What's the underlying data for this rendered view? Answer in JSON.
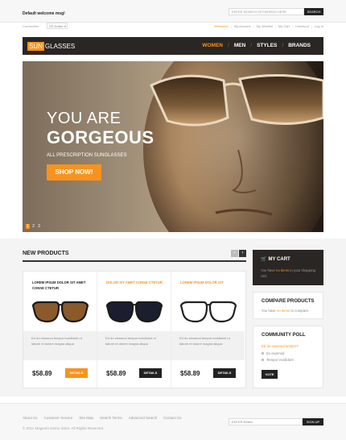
{
  "header": {
    "welcome": "Default welcome msg!",
    "search_placeholder": "ENTER SEARCH KEYWORDS HERE",
    "search_button": "SEARCH",
    "currency_label": "Currencies:",
    "currency_value": "US Dollar",
    "account_links": [
      {
        "label": "Welcome!",
        "active": true
      },
      {
        "label": "My Account",
        "active": false
      },
      {
        "label": "My Wishlist",
        "active": false
      },
      {
        "label": "My Cart",
        "active": false
      },
      {
        "label": "Checkout",
        "active": false
      },
      {
        "label": "Log In",
        "active": false
      }
    ]
  },
  "nav": {
    "logo_accent": "SUN",
    "logo_rest": "GLASSES",
    "items": [
      "WOMEN",
      "MEN",
      "STYLES",
      "BRANDS"
    ],
    "active_index": 0
  },
  "hero": {
    "line1": "YOU ARE",
    "line2": "GORGEOUS",
    "subtitle": "ALL PRESCRIPTION SUNGLASSES",
    "button": "SHOP NOW!",
    "dots": [
      "1",
      "2",
      "3"
    ],
    "active_dot": 0
  },
  "new_products": {
    "title": "NEW PRODUCTS",
    "prev_icon": "chevron-left-icon",
    "next_icon": "chevron-right-icon",
    "items": [
      {
        "name": "LOREM IPSUM DOLOR SIT AMET CONSE CTETUR",
        "highlight": false,
        "lens_color": "#8a5a2a",
        "description": "Ed do eiusmod tempor incididunt ut labore et dolore magna aliqua",
        "price": "$58.89",
        "button": "DETAILS",
        "button_orange": true
      },
      {
        "name": "DOLOR SIT AMET CONSE CTETUR",
        "highlight": true,
        "lens_color": "#1a1e2e",
        "description": "Ed do eiusmod tempor incididunt ut labore et dolore magna aliqua",
        "price": "$58.89",
        "button": "DETAILS",
        "button_orange": false
      },
      {
        "name": "LOREM IPSUM DOLOR SIT",
        "highlight": true,
        "lens_color": "#ffffff",
        "description": "Ed do eiusmod tempor incididunt ut labore et dolore magna aliqua",
        "price": "$58.89",
        "button": "DETAILS",
        "button_orange": false
      }
    ]
  },
  "sidebar": {
    "cart_title": "MY CART",
    "cart_text_before": "You have ",
    "cart_text_hl": "no items",
    "cart_text_after": " in your shopping cart.",
    "compare_title": "COMPARE PRODUCTS",
    "compare_text_before": "You have ",
    "compare_text_hl": "no items",
    "compare_text_after": " to compare.",
    "poll_title": "COMMUNITY POLL",
    "poll_question": "Ed do eiusmod tempor?",
    "poll_options": [
      "Ex eiusmod",
      "Tempor incididunt"
    ],
    "poll_button": "VOTE"
  },
  "footer": {
    "links": [
      "About Us",
      "Customer Service",
      "Site Map",
      "Search Terms",
      "Advanced Search",
      "Contact Us"
    ],
    "copyright": "© 2011 Magento Demo Store. All Rights Reserved.",
    "email_placeholder": "ENTER EMAIL",
    "signup_button": "SIGN UP"
  },
  "colors": {
    "accent": "#f7931e",
    "dark": "#2a2623"
  }
}
